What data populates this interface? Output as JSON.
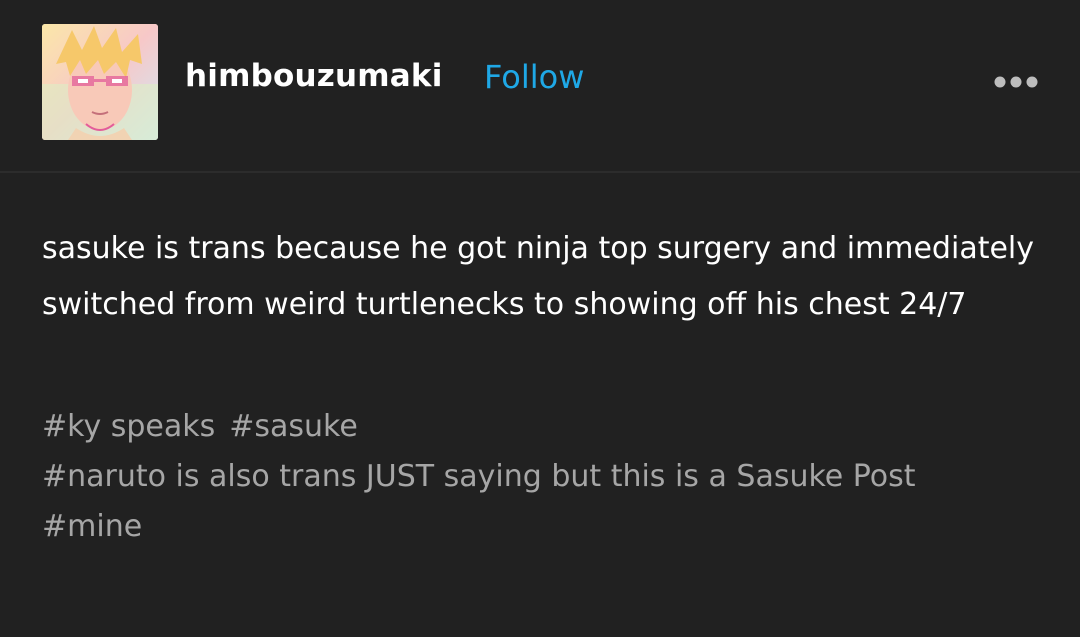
{
  "post": {
    "author": {
      "username": "himbouzumaki",
      "follow_label": "Follow",
      "avatar_icon": "anime-avatar-icon"
    },
    "more_icon": "more-options-icon",
    "body_text": "sasuke is trans because he got ninja top surgery and immediately switched from weird turtlenecks to showing off his chest 24/7",
    "tags": [
      "#ky speaks",
      "#sasuke",
      "#naruto is also trans JUST saying but this is a Sasuke Post",
      "#mine"
    ]
  },
  "colors": {
    "background": "#212121",
    "follow_accent": "#1fa8e6",
    "tag_text": "#a6a6a6",
    "body_text": "#ffffff"
  }
}
